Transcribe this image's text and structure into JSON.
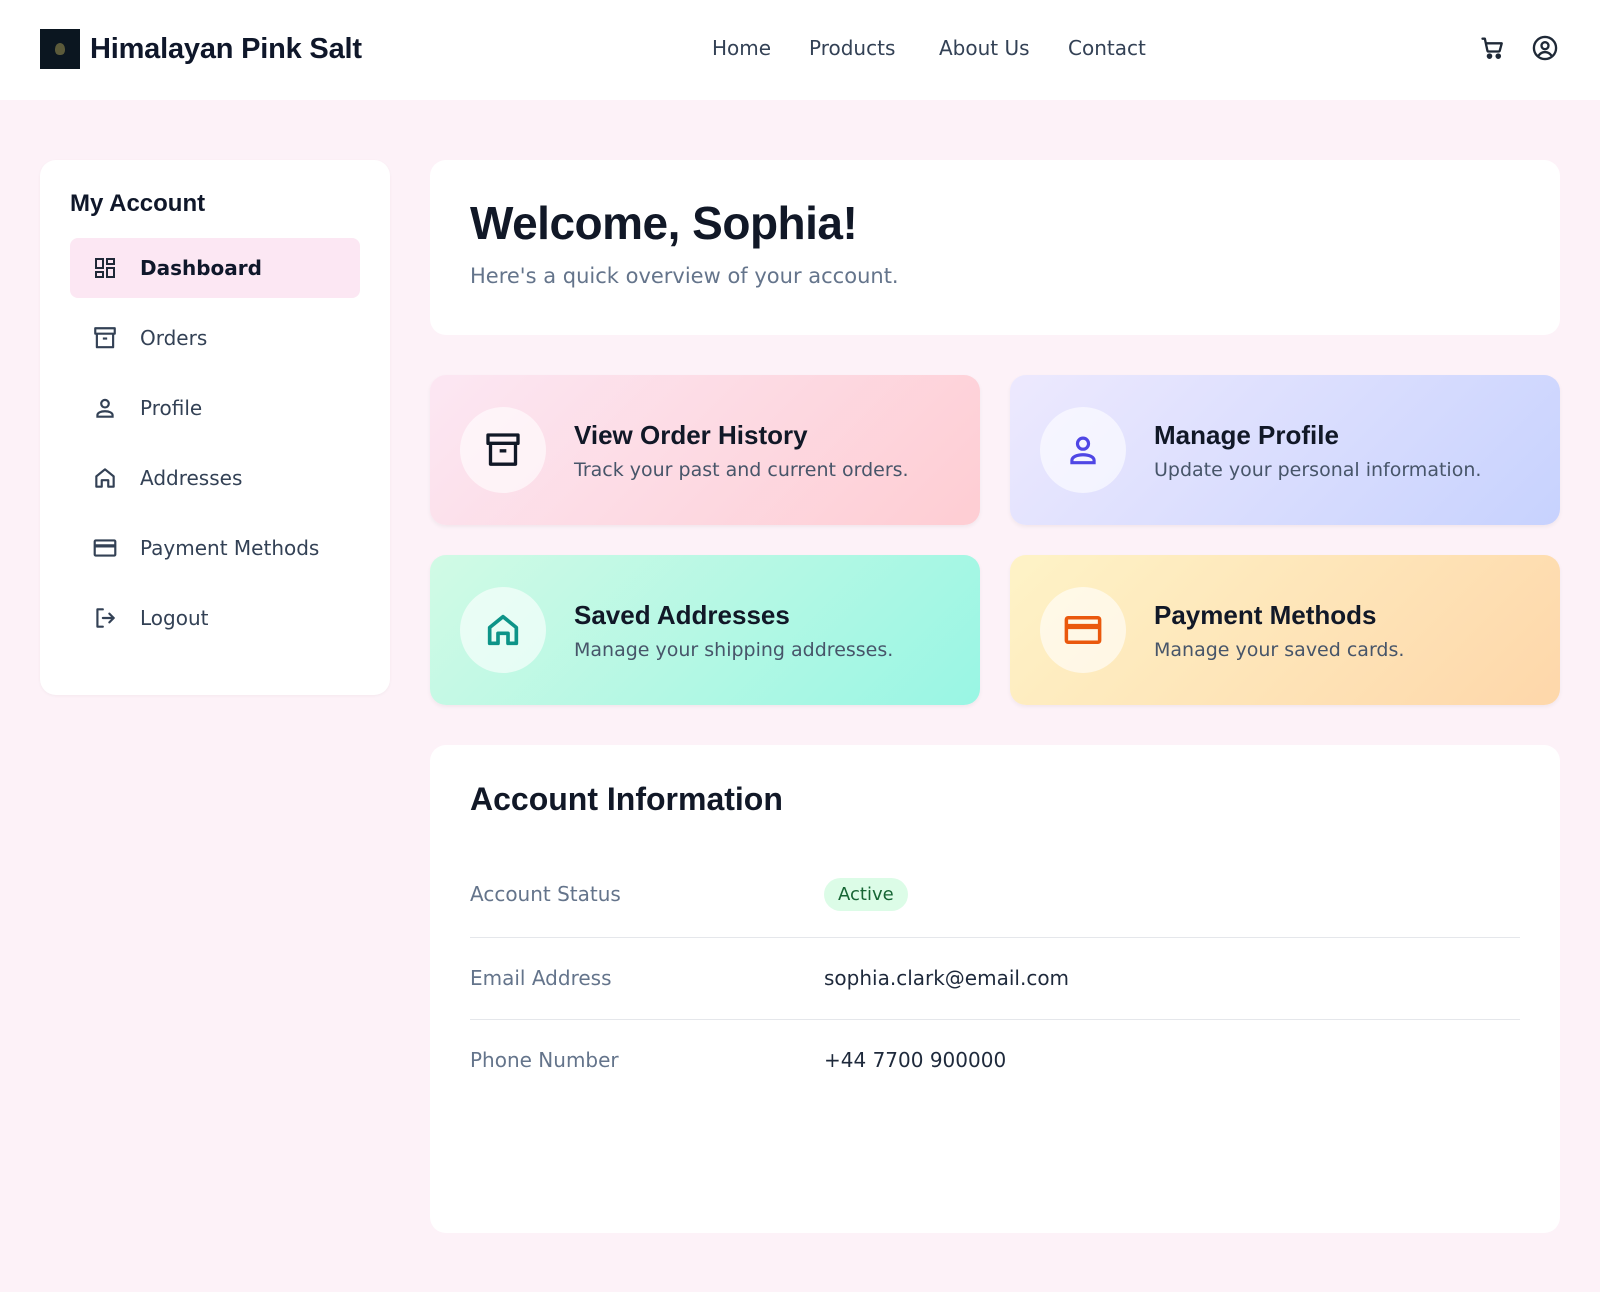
{
  "brand": {
    "name": "Himalayan Pink Salt"
  },
  "nav": {
    "items": [
      "Home",
      "Products",
      "About Us",
      "Contact"
    ]
  },
  "header_icons": [
    "cart-icon",
    "user-circle-icon"
  ],
  "sidebar": {
    "title": "My Account",
    "items": [
      {
        "label": "Dashboard",
        "icon": "dashboard-icon",
        "active": true
      },
      {
        "label": "Orders",
        "icon": "archive-box-icon"
      },
      {
        "label": "Profile",
        "icon": "user-icon"
      },
      {
        "label": "Addresses",
        "icon": "home-icon"
      },
      {
        "label": "Payment Methods",
        "icon": "credit-card-icon"
      },
      {
        "label": "Logout",
        "icon": "logout-icon"
      }
    ]
  },
  "welcome": {
    "title": "Welcome, Sophia!",
    "subtitle": "Here's a quick overview of your account."
  },
  "cards": [
    {
      "title": "View Order History",
      "desc": "Track your past and current orders.",
      "icon": "archive-box-icon",
      "accent": "#111827"
    },
    {
      "title": "Manage Profile",
      "desc": "Update your personal information.",
      "icon": "user-icon",
      "accent": "#4f46e5"
    },
    {
      "title": "Saved Addresses",
      "desc": "Manage your shipping addresses.",
      "icon": "home-icon",
      "accent": "#0d9488"
    },
    {
      "title": "Payment Methods",
      "desc": "Manage your saved cards.",
      "icon": "credit-card-icon",
      "accent": "#ea580c"
    }
  ],
  "account_info": {
    "title": "Account Information",
    "rows": [
      {
        "label": "Account Status",
        "value": "Active"
      },
      {
        "label": "Email Address",
        "value": "sophia.clark@email.com"
      },
      {
        "label": "Phone Number",
        "value": "+44 7700 900000"
      }
    ]
  },
  "colors": {
    "page_bg": "#fdf2f8",
    "active_nav_bg": "#fce7f3",
    "status_badge_bg": "#dcfce7",
    "status_badge_text": "#166534"
  }
}
